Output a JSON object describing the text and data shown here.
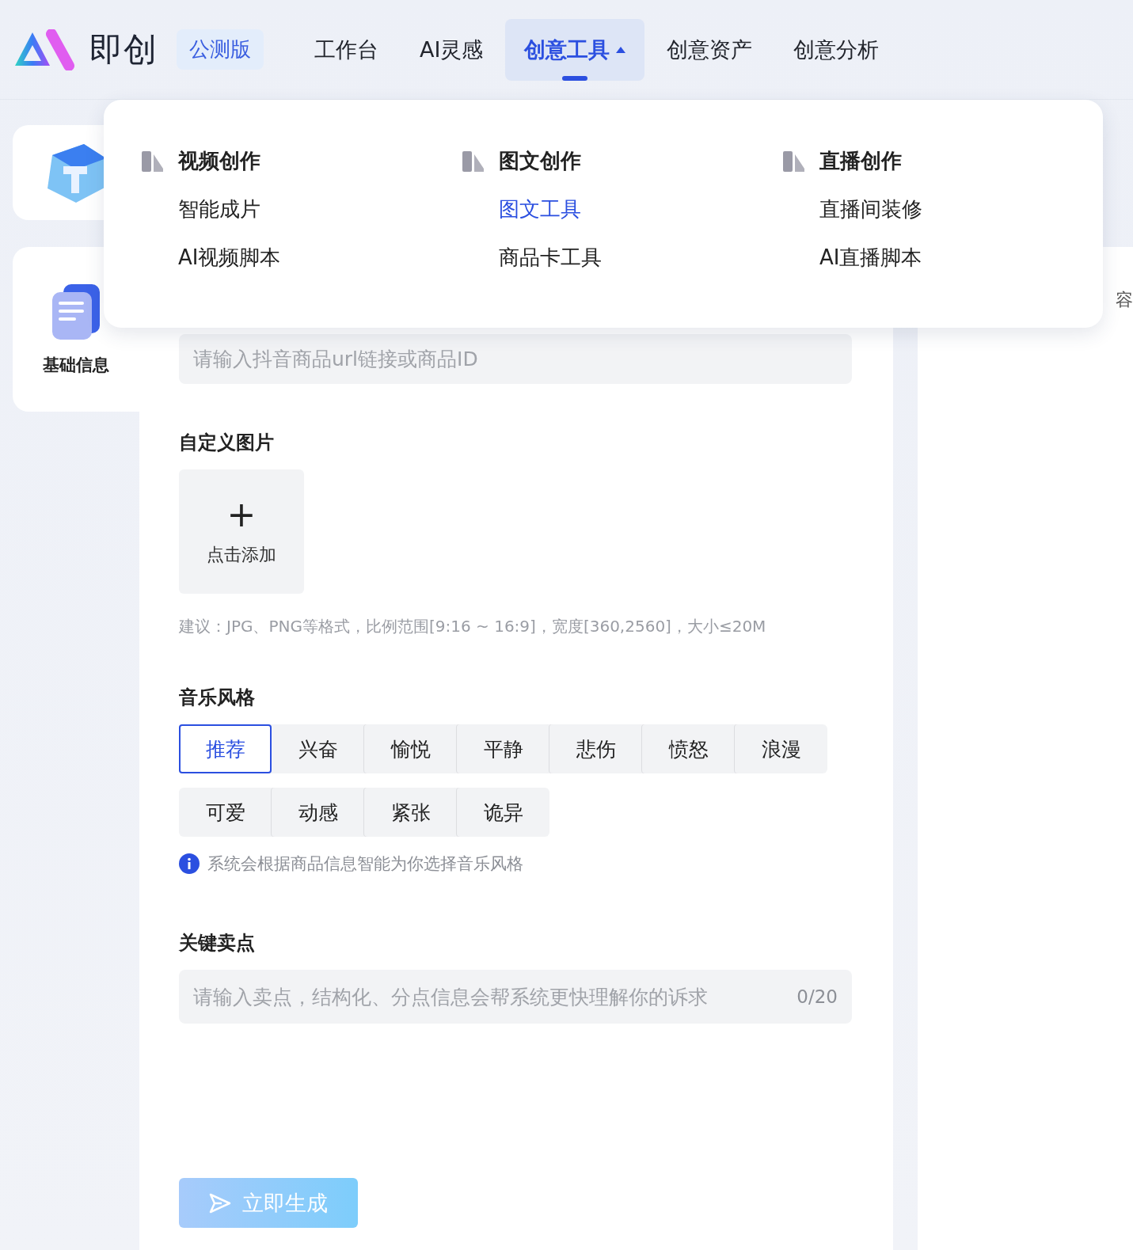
{
  "header": {
    "logo_text": "即创",
    "beta_badge": "公测版",
    "nav": [
      {
        "label": "工作台",
        "selected": false,
        "has_menu": false
      },
      {
        "label": "AI灵感",
        "selected": false,
        "has_menu": false
      },
      {
        "label": "创意工具",
        "selected": true,
        "has_menu": true
      },
      {
        "label": "创意资产",
        "selected": false,
        "has_menu": false
      },
      {
        "label": "创意分析",
        "selected": false,
        "has_menu": false
      }
    ]
  },
  "dropdown": {
    "groups": [
      {
        "title": "视频创作",
        "items": [
          {
            "label": "智能成片",
            "selected": false
          },
          {
            "label": "AI视频脚本",
            "selected": false
          }
        ]
      },
      {
        "title": "图文创作",
        "items": [
          {
            "label": "图文工具",
            "selected": true
          },
          {
            "label": "商品卡工具",
            "selected": false
          }
        ]
      },
      {
        "title": "直播创作",
        "items": [
          {
            "label": "直播间装修",
            "selected": false
          },
          {
            "label": "AI直播脚本",
            "selected": false
          }
        ]
      }
    ]
  },
  "sidebar": {
    "items": [
      {
        "kind": "cube"
      },
      {
        "label": "基础信息",
        "kind": "document"
      }
    ]
  },
  "form": {
    "product_link": {
      "placeholder": "请输入抖音商品url链接或商品ID"
    },
    "custom_image": {
      "title": "自定义图片",
      "upload_icon": "+",
      "upload_label": "点击添加",
      "hint": "建议：JPG、PNG等格式，比例范围[9:16 ~ 16:9]，宽度[360,2560]，大小≤20M"
    },
    "music_style": {
      "title": "音乐风格",
      "rows": [
        [
          {
            "label": "推荐",
            "selected": true
          },
          {
            "label": "兴奋",
            "selected": false
          },
          {
            "label": "愉悦",
            "selected": false
          },
          {
            "label": "平静",
            "selected": false
          },
          {
            "label": "悲伤",
            "selected": false
          },
          {
            "label": "愤怒",
            "selected": false
          },
          {
            "label": "浪漫",
            "selected": false
          }
        ],
        [
          {
            "label": "可爱",
            "selected": false
          },
          {
            "label": "动感",
            "selected": false
          },
          {
            "label": "紧张",
            "selected": false
          },
          {
            "label": "诡异",
            "selected": false
          }
        ]
      ],
      "note": "系统会根据商品信息智能为你选择音乐风格"
    },
    "selling_points": {
      "title": "关键卖点",
      "placeholder": "请输入卖点，结构化、分点信息会帮系统更快理解你的诉求",
      "counter": "0/20"
    },
    "submit": {
      "label": "立即生成",
      "disabled": true
    }
  },
  "right_panel": {
    "text": "容"
  }
}
